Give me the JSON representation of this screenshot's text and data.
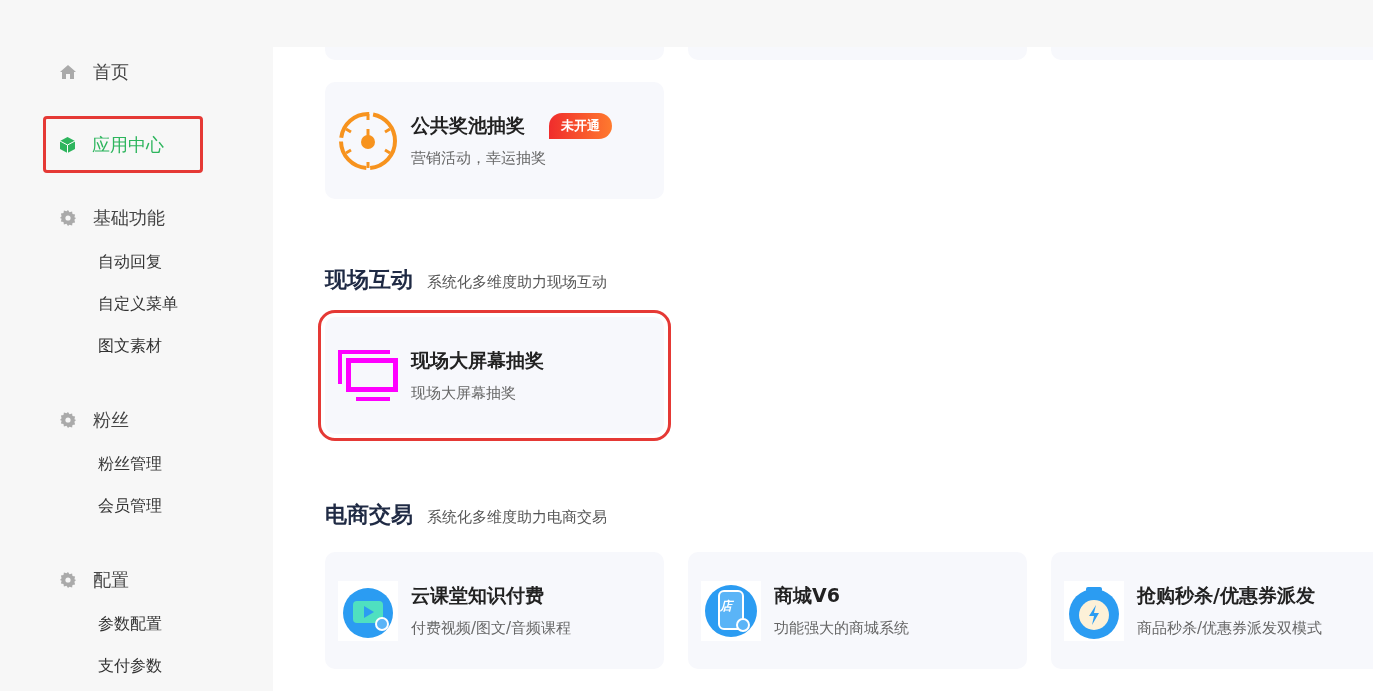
{
  "sidebar": {
    "items": [
      {
        "label": "首页",
        "kind": "home",
        "selected": false,
        "highlighted": false
      },
      {
        "label": "应用中心",
        "kind": "cube",
        "selected": true,
        "highlighted": true
      },
      {
        "label": "基础功能",
        "kind": "gear",
        "selected": false,
        "highlighted": false,
        "children": [
          {
            "label": "自动回复"
          },
          {
            "label": "自定义菜单"
          },
          {
            "label": "图文素材"
          }
        ]
      },
      {
        "label": "粉丝",
        "kind": "gear",
        "selected": false,
        "highlighted": false,
        "children": [
          {
            "label": "粉丝管理"
          },
          {
            "label": "会员管理"
          }
        ]
      },
      {
        "label": "配置",
        "kind": "gear",
        "selected": false,
        "highlighted": false,
        "children": [
          {
            "label": "参数配置"
          },
          {
            "label": "支付参数"
          }
        ]
      }
    ]
  },
  "sections": [
    {
      "cards": [
        {
          "title": "公共奖池抽奖",
          "description": "营销活动，幸运抽奖",
          "kind": "dial",
          "badge": "未开通",
          "highlighted": false
        }
      ]
    },
    {
      "title": "现场互动",
      "subtitle": "系统化多维度助力现场互动",
      "cards": [
        {
          "title": "现场大屏幕抽奖",
          "description": "现场大屏幕抽奖",
          "kind": "screens",
          "highlighted": true
        }
      ]
    },
    {
      "title": "电商交易",
      "subtitle": "系统化多维度助力电商交易",
      "cards": [
        {
          "title": "云课堂知识付费",
          "description": "付费视频/图文/音频课程",
          "kind": "tv",
          "highlighted": false
        },
        {
          "title": "商城V6",
          "description": "功能强大的商城系统",
          "kind": "shop",
          "icon_label": "店",
          "highlighted": false
        },
        {
          "title": "抢购秒杀/优惠券派发",
          "description": "商品秒杀/优惠券派发双模式",
          "kind": "timer",
          "highlighted": false
        }
      ]
    }
  ]
}
